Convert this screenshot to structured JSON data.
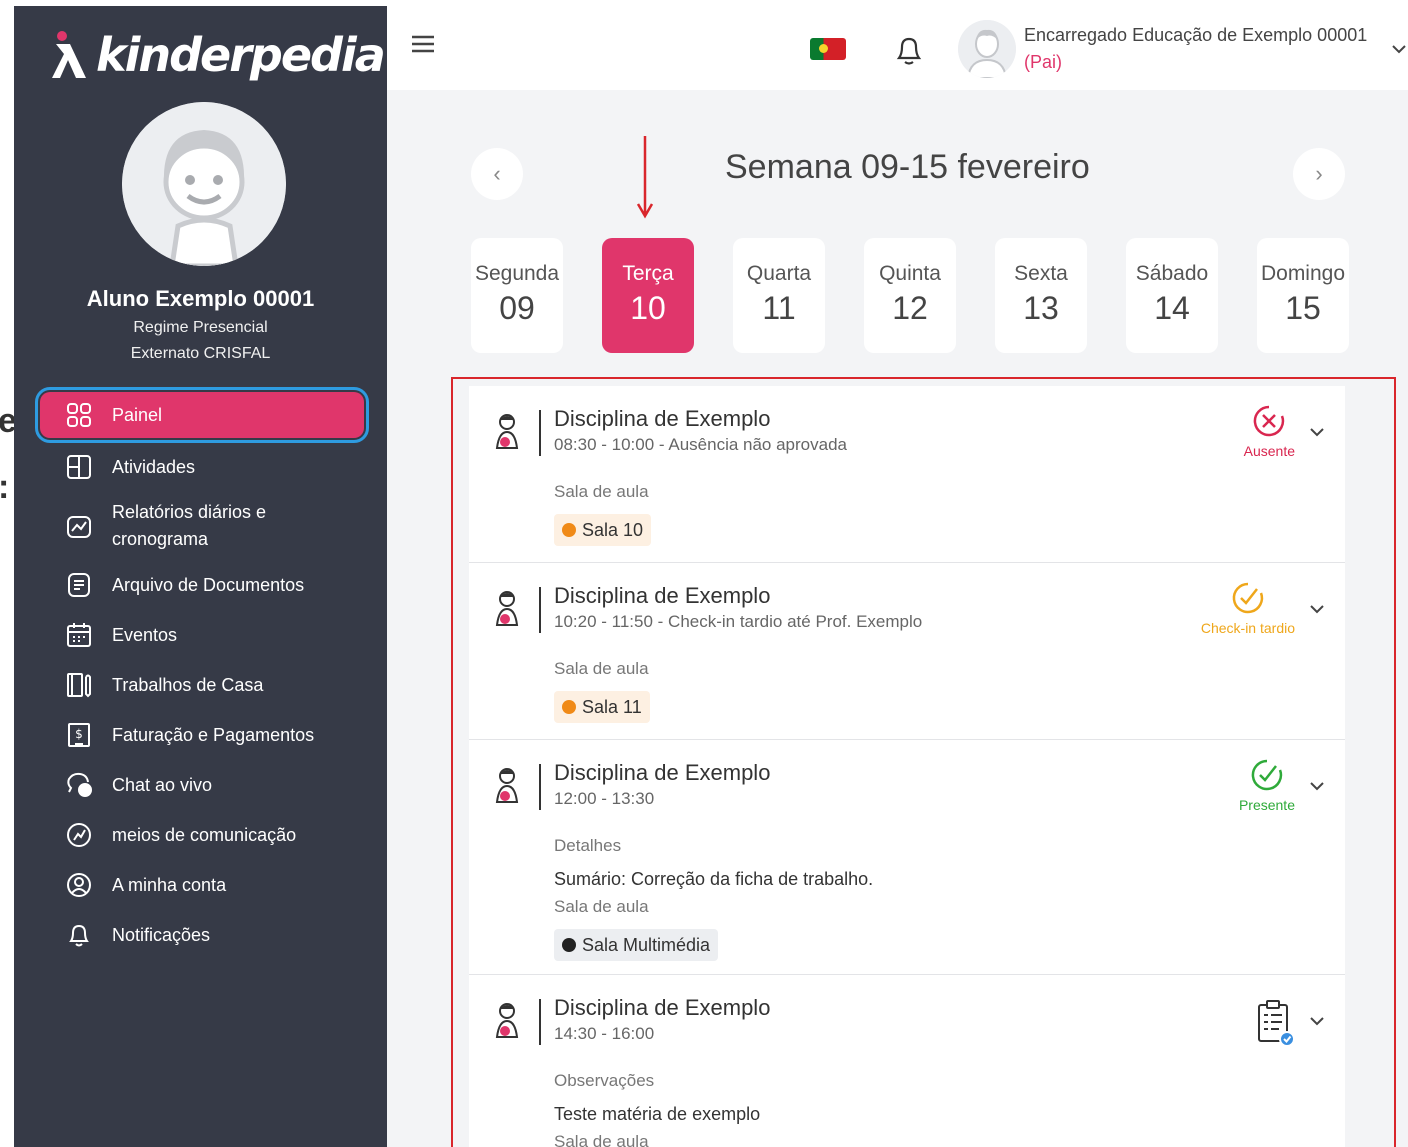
{
  "app": {
    "logo_text": "kinderpedia"
  },
  "student": {
    "name": "Aluno Exemplo 00001",
    "regime": "Regime Presencial",
    "school": "Externato CRISFAL"
  },
  "sidebar": {
    "items": [
      {
        "label": "Painel",
        "icon": "dashboard-icon",
        "active": true
      },
      {
        "label": "Atividades",
        "icon": "activities-icon"
      },
      {
        "label": "Relatórios diários e cronograma",
        "label_line1": "Relatórios diários e",
        "label_line2": "cronograma",
        "icon": "report-chart-icon"
      },
      {
        "label": "Arquivo de Documentos",
        "icon": "document-icon"
      },
      {
        "label": "Eventos",
        "icon": "calendar-icon"
      },
      {
        "label": "Trabalhos de Casa",
        "icon": "homework-icon"
      },
      {
        "label": "Faturação e Pagamentos",
        "icon": "invoice-icon"
      },
      {
        "label": "Chat ao vivo",
        "icon": "chat-icon"
      },
      {
        "label": "meios de comunicação",
        "icon": "media-icon"
      },
      {
        "label": "A minha conta",
        "icon": "account-icon"
      },
      {
        "label": "Notificações",
        "icon": "bell-icon"
      }
    ]
  },
  "header": {
    "user_name": "Encarregado Educação de Exemplo 00001",
    "user_role": "(Pai)",
    "language_flag": "portugal-flag-icon"
  },
  "week": {
    "title": "Semana 09-15 fevereiro",
    "prev_label": "‹",
    "next_label": "›",
    "days": [
      {
        "name": "Segunda",
        "date": "09"
      },
      {
        "name": "Terça",
        "date": "10",
        "active": true
      },
      {
        "name": "Quarta",
        "date": "11"
      },
      {
        "name": "Quinta",
        "date": "12"
      },
      {
        "name": "Sexta",
        "date": "13"
      },
      {
        "name": "Sábado",
        "date": "14"
      },
      {
        "name": "Domingo",
        "date": "15"
      }
    ]
  },
  "classes": [
    {
      "title": "Disciplina de Exemplo",
      "time": "08:30 - 10:00 - Ausência não aprovada",
      "status": "Ausente",
      "status_color": "#d9264f",
      "room_label": "Sala de aula",
      "room": "Sala 10",
      "room_bg": "#fdf0e2",
      "room_dot": "#f08a17"
    },
    {
      "title": "Disciplina de Exemplo",
      "time": "10:20 - 11:50 - Check-in tardio até Prof. Exemplo",
      "status": "Check-in tardio",
      "status_color": "#efa71b",
      "room_label": "Sala de aula",
      "room": "Sala 11",
      "room_bg": "#fdf0e2",
      "room_dot": "#f08a17"
    },
    {
      "title": "Disciplina de Exemplo",
      "time": "12:00 - 13:30",
      "status": "Presente",
      "status_color": "#2faa3a",
      "details_label": "Detalhes",
      "details": "Sumário: Correção da ficha de trabalho.",
      "room_label": "Sala de aula",
      "room": "Sala Multimédia",
      "room_bg": "#eceef1",
      "room_dot": "#222222"
    },
    {
      "title": "Disciplina de Exemplo",
      "time": "14:30 - 16:00",
      "status_icon": "clipboard-check-icon",
      "notes_label": "Observações",
      "notes": "Teste matéria de exemplo",
      "room_label": "Sala de aula"
    }
  ],
  "colors": {
    "sidebar_bg": "#363a47",
    "accent": "#e0366b",
    "highlight_frame": "#d9262c"
  }
}
